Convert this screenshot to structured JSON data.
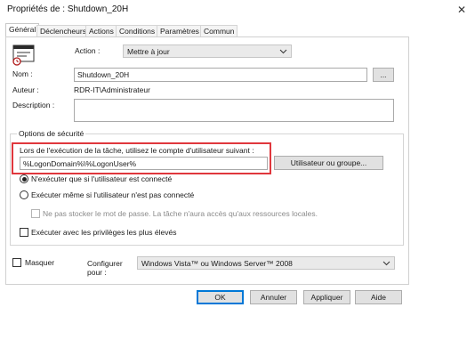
{
  "window": {
    "title": "Propriétés de : Shutdown_20H",
    "close_glyph": "✕"
  },
  "tabs": [
    {
      "label": "Général",
      "active": true
    },
    {
      "label": "Déclencheurs",
      "active": false
    },
    {
      "label": "Actions",
      "active": false
    },
    {
      "label": "Conditions",
      "active": false
    },
    {
      "label": "Paramètres",
      "active": false
    },
    {
      "label": "Commun",
      "active": false
    }
  ],
  "general": {
    "task_icon": "scheduled-task-icon",
    "action_label": "Action :",
    "action_value": "Mettre à jour",
    "name_label": "Nom :",
    "name_value": "Shutdown_20H",
    "browse_label": "...",
    "author_label": "Auteur :",
    "author_value": "RDR-IT\\Administrateur",
    "description_label": "Description :",
    "description_value": ""
  },
  "security": {
    "legend": "Options de sécurité",
    "account_prompt": "Lors de l'exécution de la tâche, utilisez le compte d'utilisateur suivant :",
    "account_value": "%LogonDomain%\\%LogonUser%",
    "user_group_button": "Utilisateur ou groupe...",
    "radio_logged_on": "N'exécuter que si l'utilisateur est connecté",
    "radio_logged_on_selected": true,
    "radio_any": "Exécuter même si l'utilisateur n'est pas connecté",
    "radio_any_selected": false,
    "no_store_password": "Ne pas stocker le mot de passe. La tâche n'aura accès qu'aux ressources locales.",
    "no_store_password_checked": false,
    "highest_privileges": "Exécuter avec les privilèges les plus élevés",
    "highest_privileges_checked": false
  },
  "bottom": {
    "hidden_label": "Masquer",
    "hidden_checked": false,
    "configure_label_line1": "Configurer",
    "configure_label_line2": "pour :",
    "configure_value": "Windows Vista™ ou Windows Server™ 2008"
  },
  "footer": {
    "ok": "OK",
    "cancel": "Annuler",
    "apply": "Appliquer",
    "help": "Aide"
  },
  "colors": {
    "highlight": "#e0373d",
    "primary_border": "#0078d7"
  }
}
